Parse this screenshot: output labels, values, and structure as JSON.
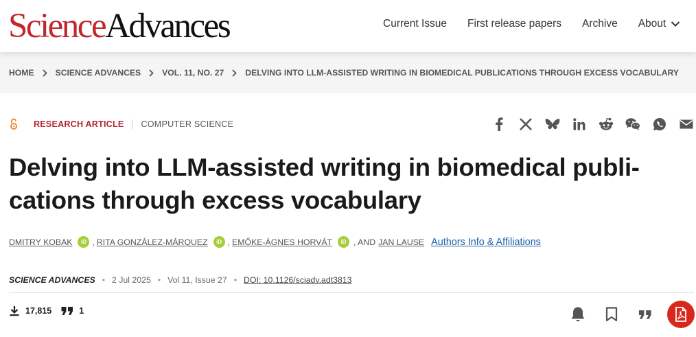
{
  "header": {
    "logo_part1": "Science",
    "logo_part2": "Advances",
    "nav": [
      "Current Issue",
      "First release papers",
      "Archive",
      "About"
    ]
  },
  "breadcrumb": [
    "HOME",
    "SCIENCE ADVANCES",
    "VOL. 11, NO. 27",
    "DELVING INTO LLM-ASSISTED WRITING IN BIOMEDICAL PUBLICATIONS THROUGH EXCESS VOCABULARY"
  ],
  "article": {
    "type": "RESEARCH ARTICLE",
    "subject": "COMPUTER SCIENCE",
    "title_line1": "Delving into LLM-assisted writing in biomedical publi-",
    "title_line2": "cations through excess vocabulary",
    "authors": [
      "DMITRY KOBAK",
      "RITA GONZÁLEZ-MÁRQUEZ",
      "EMŐKE-ÁGNES HORVÁT",
      "JAN LAUSE"
    ],
    "authors_sep": ",",
    "authors_and": ", AND",
    "orcid_label": "iD",
    "affiliations_link": "Authors Info & Affiliations",
    "journal": "SCIENCE ADVANCES",
    "date": "2 Jul 2025",
    "issue": "Vol 11, Issue 27",
    "doi": "DOI: 10.1126/sciadv.adt3813",
    "bullet": "•"
  },
  "metrics": {
    "downloads": "17,815",
    "citations": "1"
  },
  "share_icons": [
    "facebook-icon",
    "x-icon",
    "bluesky-icon",
    "linkedin-icon",
    "reddit-icon",
    "wechat-icon",
    "whatsapp-icon",
    "email-icon"
  ],
  "colors": {
    "brand_red": "#c1272d",
    "link_blue": "#1d5fa8",
    "orcid_green": "#a6ce39",
    "pdf_red": "#d7291b",
    "open_access_orange": "#f47c20"
  }
}
